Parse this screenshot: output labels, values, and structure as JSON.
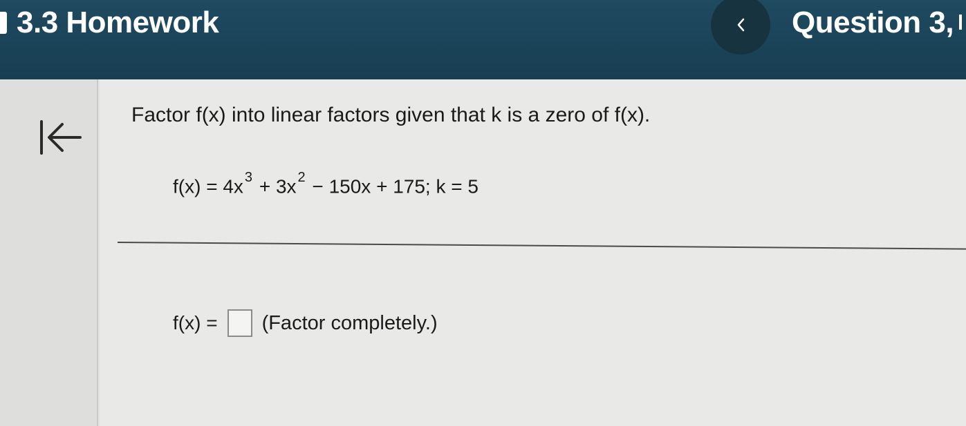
{
  "header": {
    "assignment_title": "3.3 Homework",
    "question_title": "Question 3,",
    "prev_icon": "chevron-left-icon"
  },
  "sidebar": {
    "collapse_icon": "arrow-left-to-bar-icon"
  },
  "question": {
    "instruction": "Factor f(x) into linear factors given that k is a zero of f(x).",
    "equation": {
      "lhs": "f(x) = 4x",
      "exp1": "3",
      "mid": " + 3x",
      "exp2": "2",
      "rest": " − 150x + 175; k = 5"
    },
    "answer": {
      "label": "f(x) =",
      "value": "",
      "hint": "(Factor completely.)"
    }
  },
  "colors": {
    "header_bg": "#1f4a60",
    "prev_button_bg": "#17333f",
    "page_bg": "#e9e9e7"
  }
}
